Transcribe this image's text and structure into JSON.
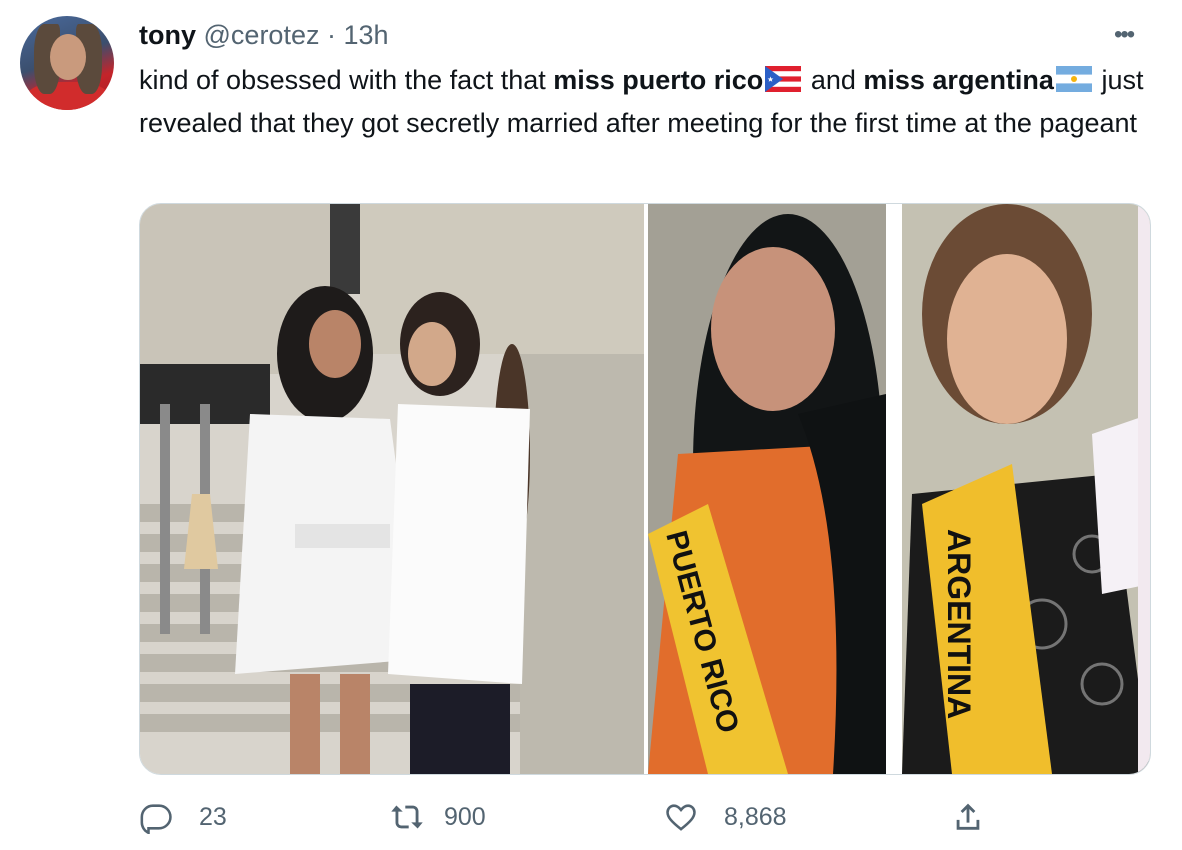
{
  "tweet": {
    "author_name": "tony",
    "handle": "@cerotez",
    "separator": "·",
    "time": "13h",
    "more_label": "•••",
    "text_parts": {
      "p1": "kind of obsessed with the fact that ",
      "b1": "miss puerto rico",
      "p2": " and ",
      "b2": "miss argentina",
      "p3": " just revealed that they got secretly married after meeting for the first time at the pageant"
    }
  },
  "media": {
    "sash_pr": "PUERTO RICO",
    "sash_ar": "ARGENTINA"
  },
  "actions": {
    "replies": "23",
    "retweets": "900",
    "likes": "8,868"
  },
  "icons": [
    "reply-icon",
    "retweet-icon",
    "like-icon",
    "share-icon",
    "more-icon"
  ],
  "colors": {
    "text": "#0f1419",
    "secondary": "#536471",
    "border": "#cfd9de"
  }
}
